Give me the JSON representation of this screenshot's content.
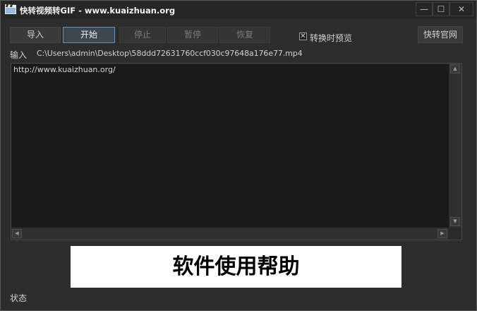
{
  "window": {
    "title": "快转视频转GIF - www.kuaizhuan.org",
    "minimize_glyph": "—",
    "maximize_glyph": "☐",
    "close_glyph": "✕"
  },
  "toolbar": {
    "import_label": "导入",
    "start_label": "开始",
    "stop_label": "停止",
    "pause_label": "暂停",
    "resume_label": "恢复",
    "preview_check_glyph": "✕",
    "preview_checked": true,
    "preview_label": "转换时预览",
    "website_label": "快转官网"
  },
  "input": {
    "label": "输入",
    "path": "C:\\Users\\admin\\Desktop\\58ddd72631760ccf030c97648a176e77.mp4"
  },
  "log": {
    "text": "http://www.kuaizhuan.org/"
  },
  "scrollbar": {
    "up": "▲",
    "down": "▼",
    "left": "◀",
    "right": "▶"
  },
  "help": {
    "label": "软件使用帮助"
  },
  "status": {
    "label": "状态"
  },
  "colors": {
    "window_bg": "#2d2d2d",
    "log_bg": "#1a1a1a",
    "active_border": "#6d8fb1",
    "banner_bg": "#ffffff"
  }
}
